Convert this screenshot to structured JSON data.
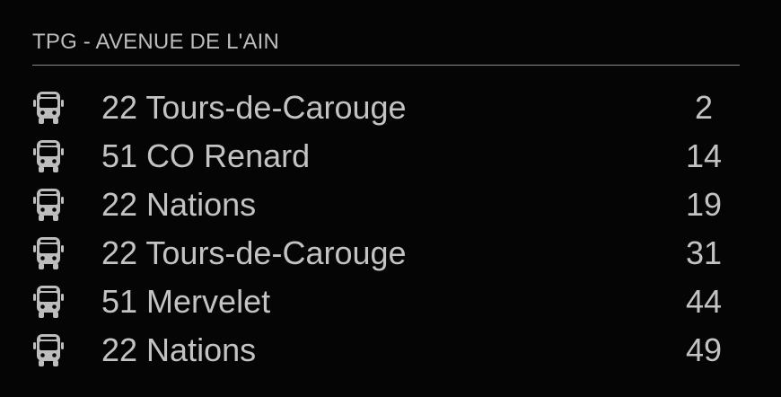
{
  "module": {
    "title": "TPG - AVENUE DE L'AIN"
  },
  "departures": [
    {
      "icon": "bus-icon",
      "destination": "22 Tours-de-Carouge",
      "minutes": "2"
    },
    {
      "icon": "bus-icon",
      "destination": "51 CO Renard",
      "minutes": "14"
    },
    {
      "icon": "bus-icon",
      "destination": "22 Nations",
      "minutes": "19"
    },
    {
      "icon": "bus-icon",
      "destination": "22 Tours-de-Carouge",
      "minutes": "31"
    },
    {
      "icon": "bus-icon",
      "destination": "51 Mervelet",
      "minutes": "44"
    },
    {
      "icon": "bus-icon",
      "destination": "22 Nations",
      "minutes": "49"
    }
  ],
  "colors": {
    "background": "#050505",
    "text": "#c3c3c3",
    "divider": "#8a8a8a"
  }
}
